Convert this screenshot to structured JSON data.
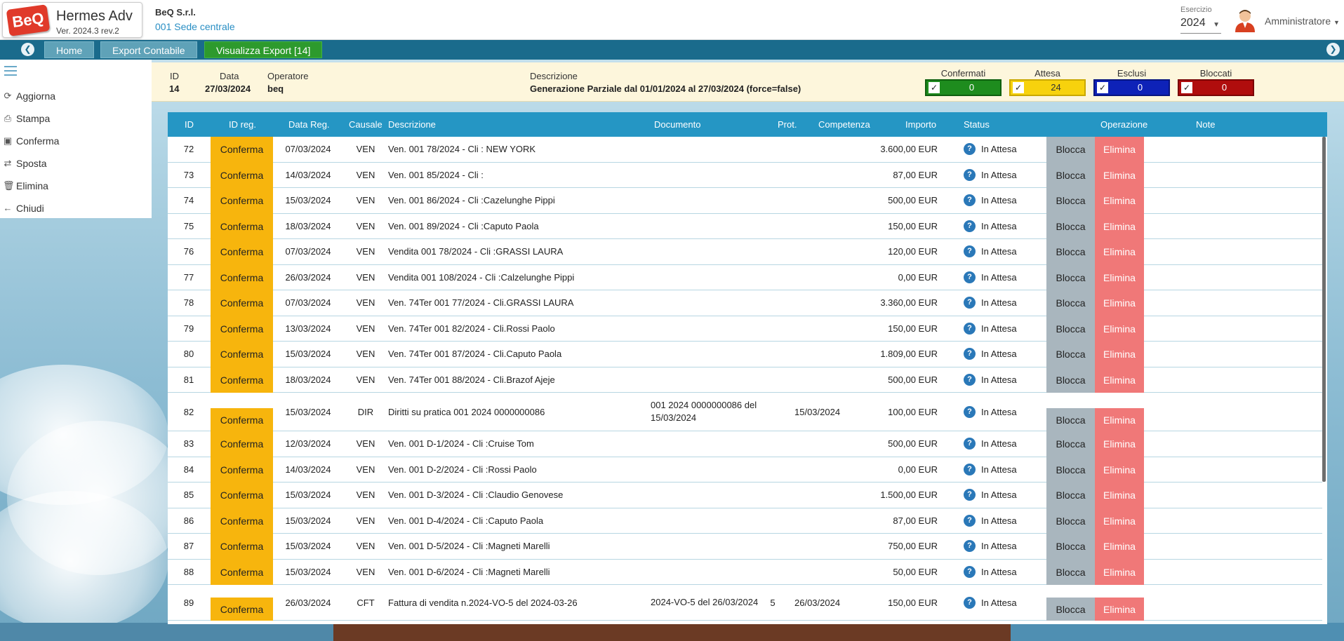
{
  "app": {
    "logo_text": "BeQ",
    "title": "Hermes Adv",
    "version": "Ver. 2024.3 rev.2"
  },
  "company": {
    "name": "BeQ S.r.l.",
    "branch": "001 Sede centrale"
  },
  "fiscal_year": {
    "label": "Esercizio",
    "value": "2024"
  },
  "user": {
    "name": "Amministratore",
    "icon": "user-avatar-icon"
  },
  "nav": {
    "home": "Home",
    "export": "Export Contabile",
    "view": "Visualizza Export [14]"
  },
  "sidebar": {
    "items": [
      {
        "label": "Aggiorna",
        "icon": "refresh-icon"
      },
      {
        "label": "Stampa",
        "icon": "print-icon"
      },
      {
        "label": "Conferma",
        "icon": "save-icon"
      },
      {
        "label": "Sposta",
        "icon": "swap-icon"
      },
      {
        "label": "Elimina",
        "icon": "trash-icon"
      },
      {
        "label": "Chiudi",
        "icon": "back-arrow-icon"
      }
    ]
  },
  "info": {
    "id_label": "ID",
    "id_value": "14",
    "date_label": "Data",
    "date_value": "27/03/2024",
    "operator_label": "Operatore",
    "operator_value": "beq",
    "desc_label": "Descrizione",
    "desc_value": "Generazione Parziale dal 01/01/2024 al 27/03/2024 (force=false)"
  },
  "counters": [
    {
      "label": "Confermati",
      "value": "0",
      "bg": "#1e8c1e",
      "border": "#0f5f0f"
    },
    {
      "label": "Attesa",
      "value": "24",
      "bg": "#f7d20d",
      "border": "#c9a800"
    },
    {
      "label": "Esclusi",
      "value": "0",
      "bg": "#0e22b8",
      "border": "#081580"
    },
    {
      "label": "Bloccati",
      "value": "0",
      "bg": "#b00d0d",
      "border": "#7a0606"
    }
  ],
  "table": {
    "headers": {
      "id": "ID",
      "idreg": "ID reg.",
      "datareg": "Data Reg.",
      "causale": "Causale",
      "descrizione": "Descrizione",
      "documento": "Documento",
      "prot": "Prot.",
      "competenza": "Competenza",
      "importo": "Importo",
      "status": "Status",
      "operazione": "Operazione",
      "note": "Note"
    },
    "confirm_label": "Conferma",
    "block_label": "Blocca",
    "delete_label": "Elimina",
    "rows": [
      {
        "id": "72",
        "date": "07/03/2024",
        "causale": "VEN",
        "desc": "Ven. 001 78/2024 - Cli : NEW YORK",
        "doc": "",
        "prot": "",
        "comp": "",
        "amount": "3.600,00 EUR",
        "status": "In Attesa"
      },
      {
        "id": "73",
        "date": "14/03/2024",
        "causale": "VEN",
        "desc": "Ven. 001 85/2024 - Cli :",
        "doc": "",
        "prot": "",
        "comp": "",
        "amount": "87,00 EUR",
        "status": "In Attesa"
      },
      {
        "id": "74",
        "date": "15/03/2024",
        "causale": "VEN",
        "desc": "Ven. 001 86/2024 - Cli :Cazelunghe Pippi",
        "doc": "",
        "prot": "",
        "comp": "",
        "amount": "500,00 EUR",
        "status": "In Attesa"
      },
      {
        "id": "75",
        "date": "18/03/2024",
        "causale": "VEN",
        "desc": "Ven. 001 89/2024 - Cli :Caputo Paola",
        "doc": "",
        "prot": "",
        "comp": "",
        "amount": "150,00 EUR",
        "status": "In Attesa"
      },
      {
        "id": "76",
        "date": "07/03/2024",
        "causale": "VEN",
        "desc": "Vendita 001 78/2024 - Cli :GRASSI LAURA",
        "doc": "",
        "prot": "",
        "comp": "",
        "amount": "120,00 EUR",
        "status": "In Attesa"
      },
      {
        "id": "77",
        "date": "26/03/2024",
        "causale": "VEN",
        "desc": "Vendita 001 108/2024 - Cli :Calzelunghe Pippi",
        "doc": "",
        "prot": "",
        "comp": "",
        "amount": "0,00 EUR",
        "status": "In Attesa"
      },
      {
        "id": "78",
        "date": "07/03/2024",
        "causale": "VEN",
        "desc": "Ven. 74Ter 001 77/2024 - Cli.GRASSI LAURA",
        "doc": "",
        "prot": "",
        "comp": "",
        "amount": "3.360,00 EUR",
        "status": "In Attesa"
      },
      {
        "id": "79",
        "date": "13/03/2024",
        "causale": "VEN",
        "desc": "Ven. 74Ter 001 82/2024 - Cli.Rossi Paolo",
        "doc": "",
        "prot": "",
        "comp": "",
        "amount": "150,00 EUR",
        "status": "In Attesa"
      },
      {
        "id": "80",
        "date": "15/03/2024",
        "causale": "VEN",
        "desc": "Ven. 74Ter 001 87/2024 - Cli.Caputo Paola",
        "doc": "",
        "prot": "",
        "comp": "",
        "amount": "1.809,00 EUR",
        "status": "In Attesa"
      },
      {
        "id": "81",
        "date": "18/03/2024",
        "causale": "VEN",
        "desc": "Ven. 74Ter 001 88/2024 - Cli.Brazof Ajeje",
        "doc": "",
        "prot": "",
        "comp": "",
        "amount": "500,00 EUR",
        "status": "In Attesa"
      },
      {
        "id": "82",
        "date": "15/03/2024",
        "causale": "DIR",
        "desc": "Diritti su pratica 001 2024 0000000086",
        "doc": "001 2024 0000000086 del 15/03/2024",
        "prot": "",
        "comp": "15/03/2024",
        "amount": "100,00 EUR",
        "status": "In Attesa"
      },
      {
        "id": "83",
        "date": "12/03/2024",
        "causale": "VEN",
        "desc": "Ven. 001 D-1/2024 - Cli :Cruise Tom",
        "doc": "",
        "prot": "",
        "comp": "",
        "amount": "500,00 EUR",
        "status": "In Attesa"
      },
      {
        "id": "84",
        "date": "14/03/2024",
        "causale": "VEN",
        "desc": "Ven. 001 D-2/2024 - Cli :Rossi Paolo",
        "doc": "",
        "prot": "",
        "comp": "",
        "amount": "0,00 EUR",
        "status": "In Attesa"
      },
      {
        "id": "85",
        "date": "15/03/2024",
        "causale": "VEN",
        "desc": "Ven. 001 D-3/2024 - Cli :Claudio Genovese",
        "doc": "",
        "prot": "",
        "comp": "",
        "amount": "1.500,00 EUR",
        "status": "In Attesa"
      },
      {
        "id": "86",
        "date": "15/03/2024",
        "causale": "VEN",
        "desc": "Ven. 001 D-4/2024 - Cli :Caputo Paola",
        "doc": "",
        "prot": "",
        "comp": "",
        "amount": "87,00 EUR",
        "status": "In Attesa"
      },
      {
        "id": "87",
        "date": "15/03/2024",
        "causale": "VEN",
        "desc": "Ven. 001 D-5/2024 - Cli :Magneti Marelli",
        "doc": "",
        "prot": "",
        "comp": "",
        "amount": "750,00 EUR",
        "status": "In Attesa"
      },
      {
        "id": "88",
        "date": "15/03/2024",
        "causale": "VEN",
        "desc": "Ven. 001 D-6/2024 - Cli :Magneti Marelli",
        "doc": "",
        "prot": "",
        "comp": "",
        "amount": "50,00 EUR",
        "status": "In Attesa"
      },
      {
        "id": "89",
        "date": "26/03/2024",
        "causale": "CFT",
        "desc": "Fattura di vendita n.2024-VO-5 del 2024-03-26",
        "doc": "2024-VO-5 del 26/03/2024",
        "prot": "5",
        "comp": "26/03/2024",
        "amount": "150,00 EUR",
        "status": "In Attesa"
      }
    ]
  }
}
